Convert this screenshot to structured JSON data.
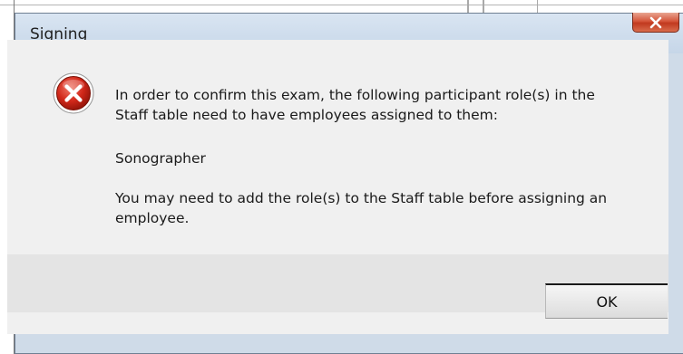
{
  "dialog": {
    "title": "Signing",
    "close_label": "X",
    "message": {
      "paragraph1": "In order to confirm this exam, the following participant role(s) in the Staff table need to have employees assigned to them:",
      "paragraph1_line1": "In order to confirm this exam, the following participant role(s) in the",
      "paragraph1_line2": "Staff table need to have employees assigned to them:",
      "role": "Sonographer",
      "paragraph3_line1": "You may need to add the role(s) to the Staff table before assigning an",
      "paragraph3_line2": "employee."
    },
    "ok_label": "OK",
    "icon": "error-icon"
  },
  "colors": {
    "titlebar": "#c6d6e8",
    "content_bg": "#f0f0f0",
    "close_red": "#c1391f"
  }
}
